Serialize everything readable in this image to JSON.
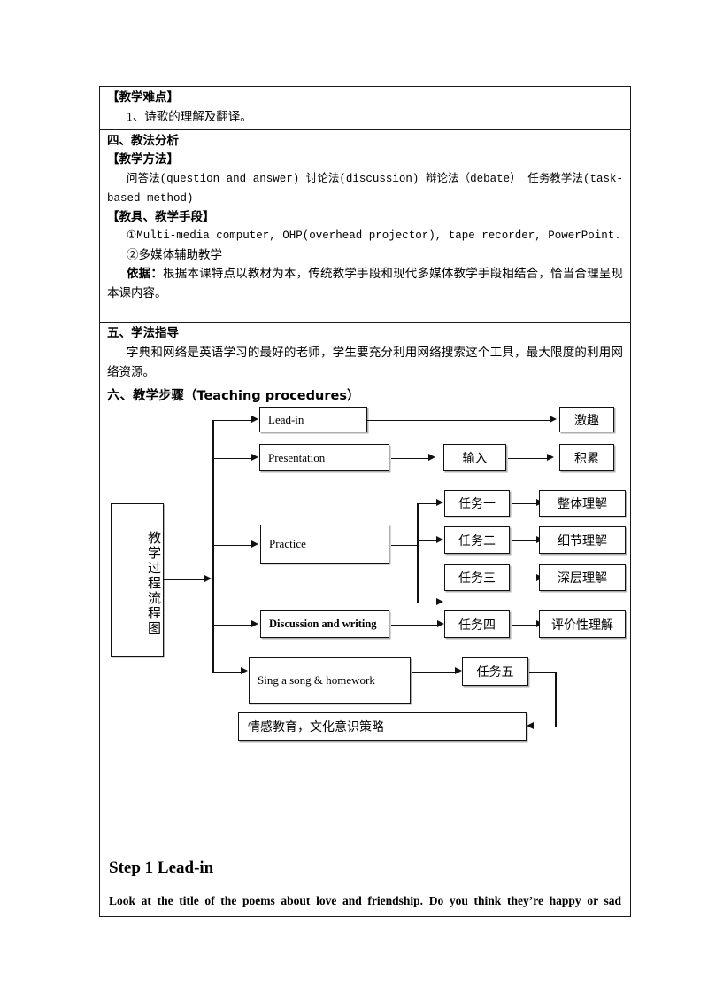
{
  "document": {
    "sections": [
      {
        "id": "difficulty",
        "heading": "【教学难点】",
        "body": "1、诗歌的理解及翻译。"
      },
      {
        "id": "methods",
        "heading": "四、教法分析",
        "sub_heading_1": "【教学方法】",
        "methods_line": "问答法(question and answer) 讨论法(discussion) 辩论法（debate） 任务教学法(task-based method)",
        "sub_heading_2": "【教具、教学手段】",
        "aid_1": "①Multi-media computer, OHP(overhead projector), tape recorder, PowerPoint.",
        "aid_2": "②多媒体辅助教学",
        "basis_label": "依据：",
        "basis_text": "根据本课特点以教材为本，传统教学手段和现代多媒体教学手段相结合，恰当合理呈现本课内容。"
      },
      {
        "id": "study-guidance",
        "heading": "五、学法指导",
        "body": "字典和网络是英语学习的最好的老师，学生要充分利用网络搜索这个工具，最大限度的利用网络资源。"
      },
      {
        "id": "procedures",
        "heading": "六、教学步骤（Teaching procedures）"
      }
    ]
  },
  "flowchart": {
    "root_label": "教学过程流程图",
    "nodes": {
      "lead_in": "Lead-in",
      "presentation": "Presentation",
      "practice": "Practice",
      "discussion": "Discussion and writing",
      "sing_song": "Sing a song & homework",
      "input": "输入",
      "interest": "激趣",
      "accumulate": "积累",
      "task1": "任务一",
      "task2": "任务二",
      "task3": "任务三",
      "task4": "任务四",
      "task5": "任务五",
      "overall": "整体理解",
      "detail": "细节理解",
      "deep": "深层理解",
      "evaluative": "评价性理解",
      "emotion": "情感教育，文化意识策略"
    }
  },
  "step": {
    "title": "Step 1 Lead-in",
    "body": "Look at the title of the poems about love and friendship. Do you think they’re happy or sad"
  }
}
